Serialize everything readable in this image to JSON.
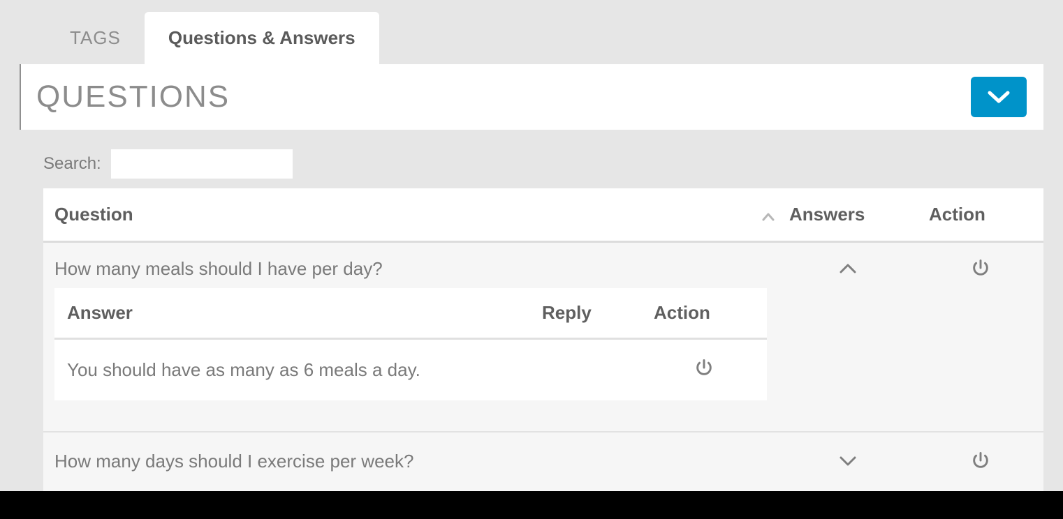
{
  "tabs": {
    "tags": "TAGS",
    "qa": "Questions & Answers"
  },
  "section": {
    "title": "QUESTIONS"
  },
  "search": {
    "label": "Search:",
    "value": ""
  },
  "table": {
    "headers": {
      "question": "Question",
      "answers": "Answers",
      "action": "Action"
    },
    "inner_headers": {
      "answer": "Answer",
      "reply": "Reply",
      "action": "Action"
    },
    "rows": [
      {
        "question": "How many meals should I have per day?",
        "expanded": true,
        "answers": [
          {
            "text": "You should have as many as 6 meals a day.",
            "reply": ""
          }
        ]
      },
      {
        "question": "How many days should I exercise per week?",
        "expanded": false,
        "answers": []
      }
    ]
  }
}
